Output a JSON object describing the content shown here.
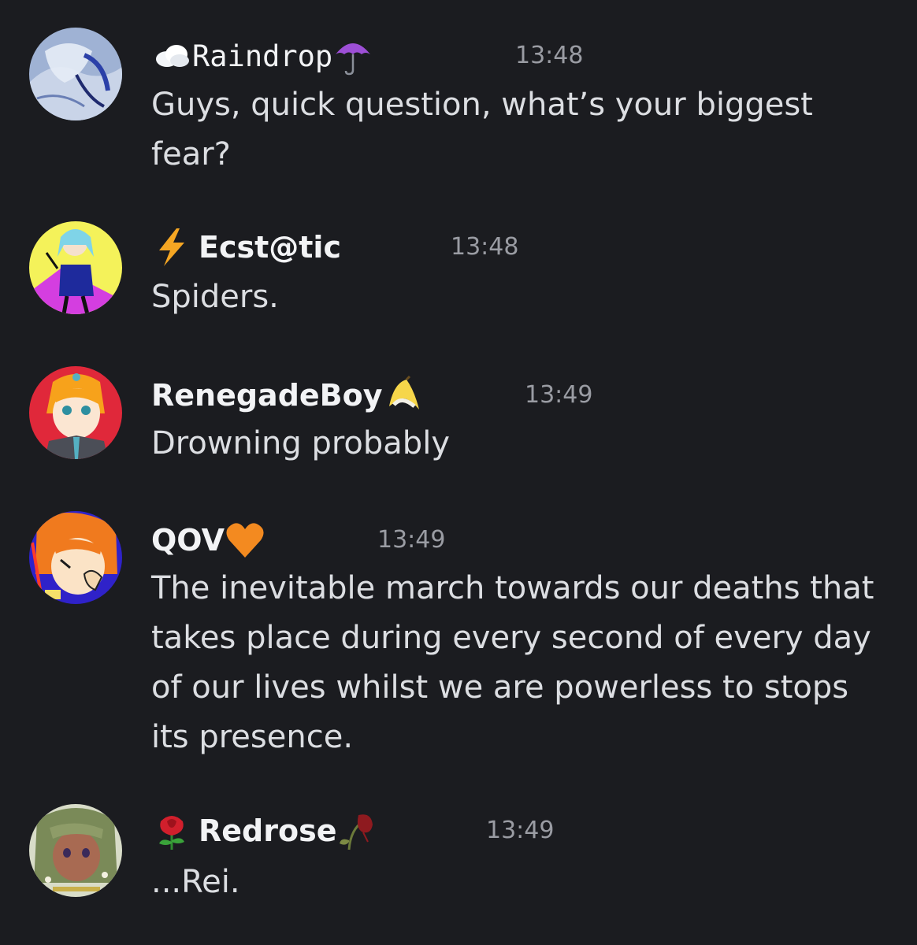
{
  "colors": {
    "background": "#1b1c20",
    "author": "#f2f3f5",
    "timestamp": "#9a9ca3",
    "content": "#dcdee2"
  },
  "messages": [
    {
      "author": "Raindrop",
      "prefix_icon": "cloud-icon",
      "suffix_icon": "umbrella-icon",
      "timestamp": "13:48",
      "content": "Guys, quick question, what’s your biggest fear?"
    },
    {
      "author": "Ecst@tic",
      "prefix_icon": "lightning-icon",
      "timestamp": "13:48",
      "content": "Spiders."
    },
    {
      "author": "RenegadeBoy",
      "suffix_icon": "banana-icon",
      "timestamp": "13:49",
      "content": "Drowning probably"
    },
    {
      "author": "QOV",
      "suffix_icon": "orange-heart-icon",
      "timestamp": "13:49",
      "content": "The inevitable march towards our deaths that takes place during every second of every day of our lives whilst we are powerless to stops its presence."
    },
    {
      "author": "Redrose",
      "prefix_icon": "rose-icon",
      "suffix_icon": "wilted-flower-icon",
      "timestamp": "13:49",
      "content": "...Rei."
    }
  ]
}
